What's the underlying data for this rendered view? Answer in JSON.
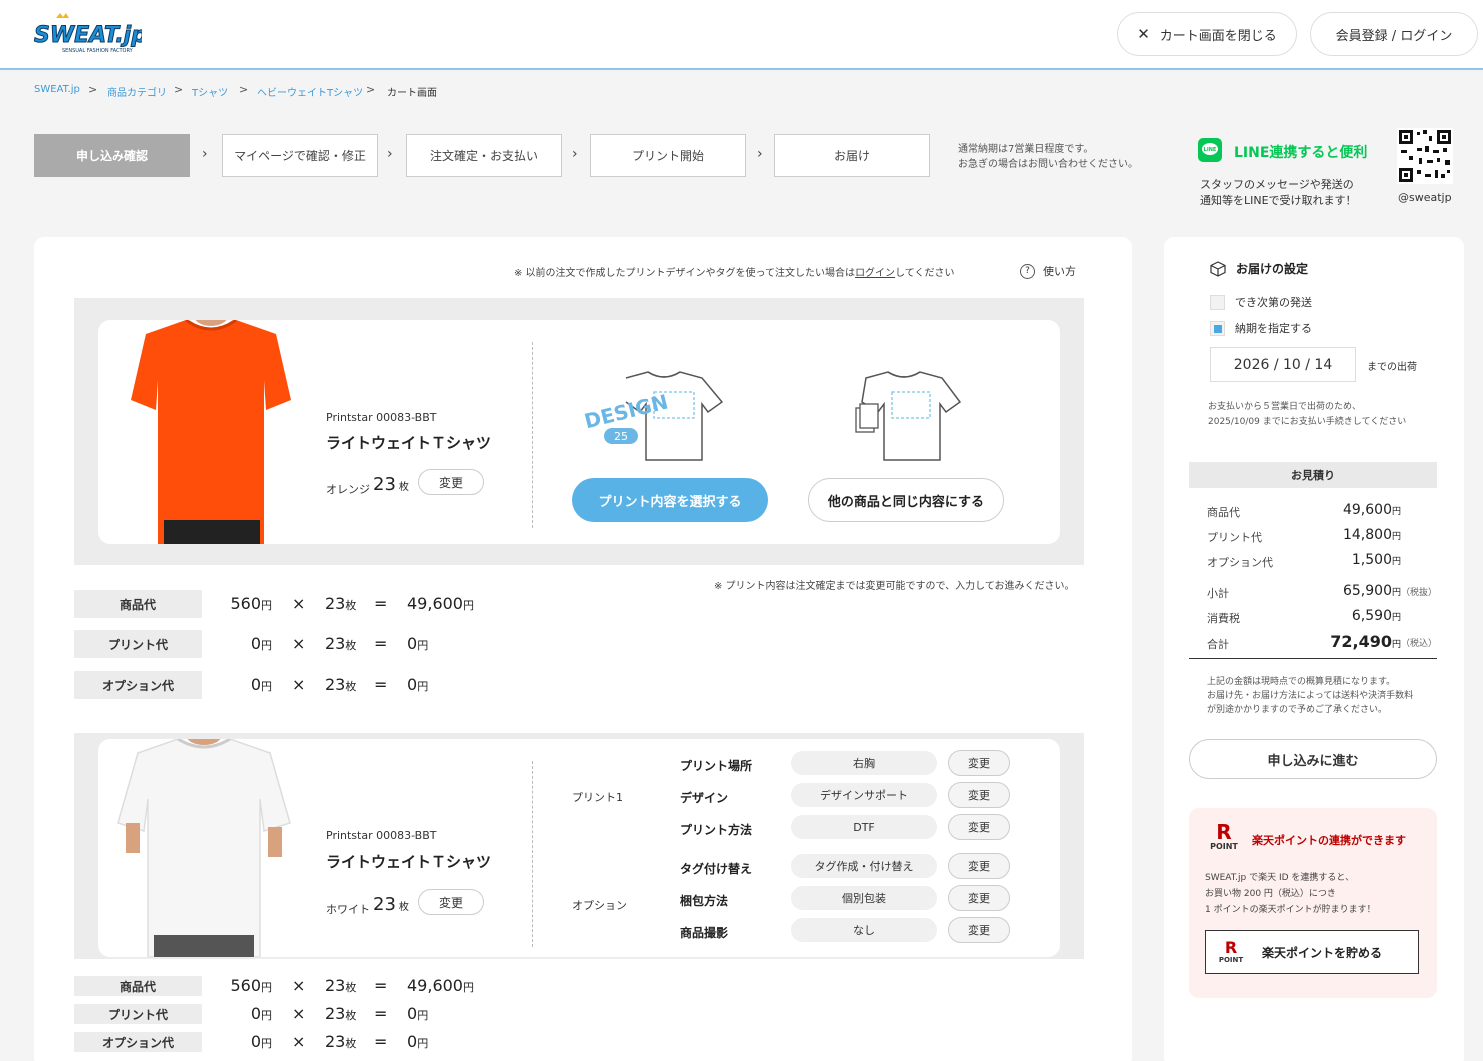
{
  "header": {
    "logo_text": "SWEAT.jp",
    "logo_sub": "SENSUAL FASHION FACTORY",
    "close_cart_label": "カート画面を閉じる",
    "login_label": "会員登録 / ログイン"
  },
  "breadcrumb": [
    "SWEAT.jp",
    "商品カテゴリ",
    "Tシャツ",
    "ヘビーウェイトTシャツ",
    "カート画面"
  ],
  "steps": [
    "申し込み確認",
    "マイページで確認・修正",
    "注文確定・お支払い",
    "プリント開始",
    "お届け"
  ],
  "delivery_note": [
    "通常納期は7営業日程度です。",
    "お急ぎの場合はお問い合わせください。"
  ],
  "line": {
    "title": "LINE連携すると便利",
    "desc1": "スタッフのメッセージや発送の",
    "desc2": "通知等をLINEで受け取れます！",
    "handle": "@sweatjp"
  },
  "login_note": {
    "prefix": "※ 以前の注文で作成したプリントデザインやタグを使って注文したい場合は",
    "link": "ログイン",
    "suffix": "してください",
    "help": "使い方"
  },
  "product1": {
    "maker": "Printstar 00083-BBT",
    "name": "ライトウェイトＴシャツ",
    "color": "オレンジ",
    "qty": "23",
    "qty_unit": "枚",
    "change": "変更",
    "design_text": "DESIGN",
    "design_num": "25",
    "select_print": "プリント内容を選択する",
    "same_as_other": "他の商品と同じ内容にする",
    "print_note": "※ プリント内容は注文確定までは変更可能ですので、入力してお進みください。",
    "prices": [
      {
        "label": "商品代",
        "unit_price": "560",
        "qty": "23",
        "total": "49,600"
      },
      {
        "label": "プリント代",
        "unit_price": "0",
        "qty": "23",
        "total": "0"
      },
      {
        "label": "オプション代",
        "unit_price": "0",
        "qty": "23",
        "total": "0"
      }
    ]
  },
  "product2": {
    "maker": "Printstar 00083-BBT",
    "name": "ライトウェイトＴシャツ",
    "color": "ホワイト",
    "qty": "23",
    "qty_unit": "枚",
    "change": "変更",
    "print_group": "プリント1",
    "option_group": "オプション",
    "settings": [
      {
        "label": "プリント場所",
        "value": "右胸"
      },
      {
        "label": "デザイン",
        "value": "デザインサポート"
      },
      {
        "label": "プリント方法",
        "value": "DTF"
      },
      {
        "label": "タグ付け替え",
        "value": "タグ作成・付け替え"
      },
      {
        "label": "梱包方法",
        "value": "個別包装"
      },
      {
        "label": "商品撮影",
        "value": "なし"
      }
    ],
    "prices": [
      {
        "label": "商品代",
        "unit_price": "560",
        "qty": "23",
        "total": "49,600"
      },
      {
        "label": "プリント代",
        "unit_price": "0",
        "qty": "23",
        "total": "0"
      },
      {
        "label": "オプション代",
        "unit_price": "0",
        "qty": "23",
        "total": "0"
      }
    ]
  },
  "symbols": {
    "times": "×",
    "equals": "=",
    "yen": "円",
    "mai": "枚"
  },
  "delivery": {
    "title": "お届けの設定",
    "option1": "でき次第の発送",
    "option2": "納期を指定する",
    "date": "2026 / 10 / 14",
    "date_suffix": "までの出荷",
    "pay_note1": "お支払いから５営業日で出荷のため、",
    "pay_note2": "2025/10/09 までにお支払い手続きしてください"
  },
  "estimate": {
    "title": "お見積り",
    "rows": [
      {
        "label": "商品代",
        "value": "49,600",
        "tax": ""
      },
      {
        "label": "プリント代",
        "value": "14,800",
        "tax": ""
      },
      {
        "label": "オプション代",
        "value": "1,500",
        "tax": ""
      },
      {
        "label": "小計",
        "value": "65,900",
        "tax": "（税抜）"
      },
      {
        "label": "消費税",
        "value": "6,590",
        "tax": ""
      },
      {
        "label": "合計",
        "value": "72,490",
        "tax": "（税込）"
      }
    ],
    "note1": "上記の金額は現時点での概算見積になります。",
    "note2": "お届け先・お届け方法によっては送料や決済手数料",
    "note3": "が別途かかりますので予めご了承ください。",
    "proceed": "申し込みに進む"
  },
  "rakuten": {
    "title": "楽天ポイントの連携ができます",
    "point_label": "POINT",
    "desc1": "SWEAT.jp で楽天 ID を連携すると、",
    "desc2": "お買い物 200 円（税込）につき",
    "desc3": "1 ポイントの楽天ポイントが貯まります！",
    "button": "楽天ポイントを貯める"
  }
}
